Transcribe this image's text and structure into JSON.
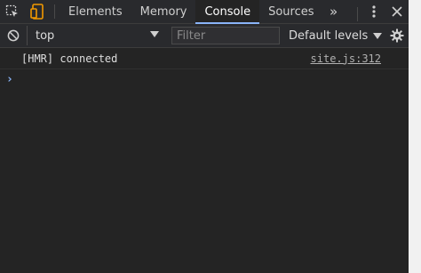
{
  "tabs": [
    {
      "label": "Elements",
      "active": false
    },
    {
      "label": "Memory",
      "active": false
    },
    {
      "label": "Console",
      "active": true
    },
    {
      "label": "Sources",
      "active": false
    }
  ],
  "more_tabs": "»",
  "toolbar": {
    "context": "top",
    "filter_placeholder": "Filter",
    "levels_label": "Default levels"
  },
  "console": {
    "messages": [
      {
        "text": "[HMR] connected",
        "source": "site.js:312"
      }
    ],
    "prompt": "›"
  },
  "colors": {
    "accent": "#8ab4f8",
    "panel_bg": "#242424",
    "toolbar_bg": "#292a2d",
    "device_icon": "#f29900"
  },
  "icons": [
    "inspect-element-icon",
    "device-toggle-icon",
    "more-tabs-icon",
    "kebab-menu-icon",
    "close-icon",
    "clear-console-icon",
    "dropdown-caret-icon",
    "settings-gear-icon",
    "prompt-chevron-icon"
  ]
}
